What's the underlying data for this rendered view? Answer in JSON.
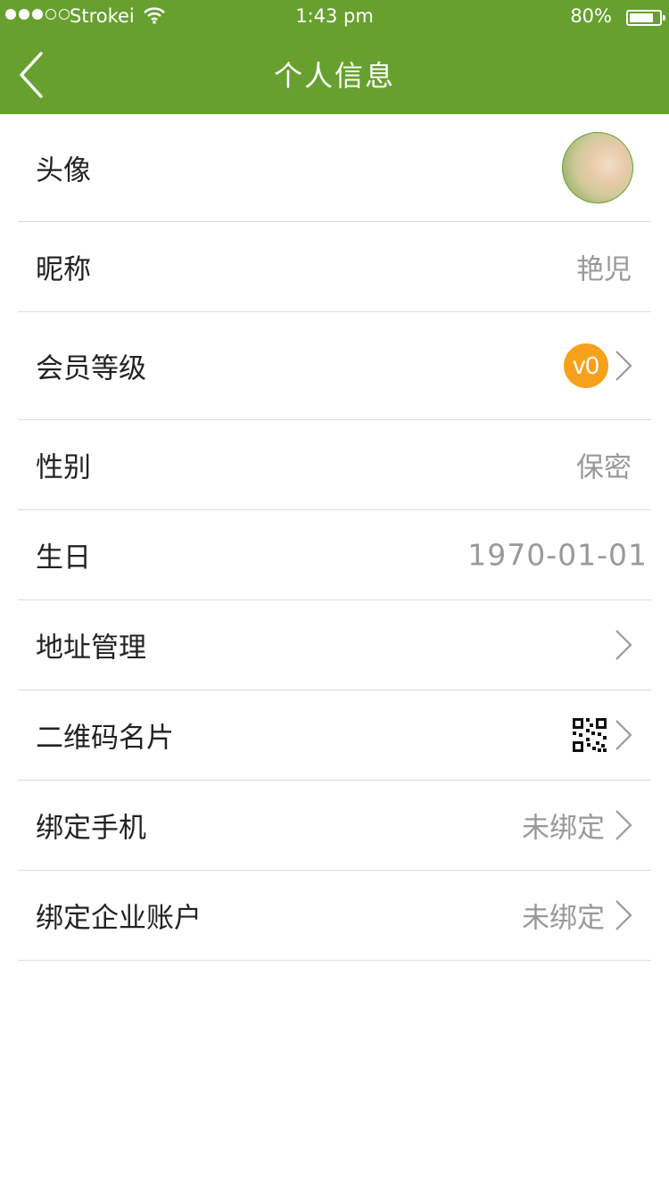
{
  "status_bar": {
    "carrier": "Strokei",
    "time": "1:43 pm",
    "battery": "80%",
    "battery_level": 0.8,
    "signal_bars_filled": 3,
    "signal_bars_total": 5
  },
  "nav": {
    "title": "个人信息",
    "back_icon": "chevron-left-icon"
  },
  "colors": {
    "header_bg": "#67a02e",
    "badge": "#f7a11a",
    "label_text": "#222222",
    "value_text": "#999999",
    "divider": "#dcdcdc"
  },
  "rows": [
    {
      "label": "头像",
      "type": "avatar"
    },
    {
      "label": "昵称",
      "value": "艳児"
    },
    {
      "label": "会员等级",
      "badge": "v0",
      "chevron": true
    },
    {
      "label": "性别",
      "value": "保密"
    },
    {
      "label": "生日",
      "value": "1970-01-01"
    },
    {
      "label": "地址管理",
      "chevron": true
    },
    {
      "label": "二维码名片",
      "icon": "qr-code-icon",
      "chevron": true
    },
    {
      "label": "绑定手机",
      "value": "未绑定",
      "chevron": true
    },
    {
      "label": "绑定企业账户",
      "value": "未绑定",
      "chevron": true
    }
  ]
}
